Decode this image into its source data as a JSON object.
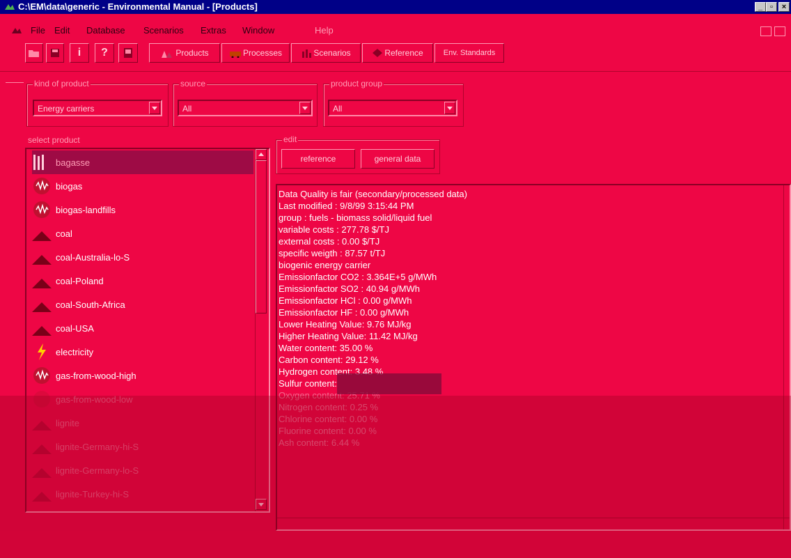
{
  "window": {
    "title": "C:\\EM\\data\\generic - Environmental Manual - [Products]"
  },
  "menu": [
    "File",
    "Edit",
    "Database",
    "Scenarios",
    "Extras",
    "Window",
    "Help"
  ],
  "toolbar": {
    "tabs": [
      "Products",
      "Processes",
      "Scenarios",
      "Reference",
      "Env. Standards"
    ]
  },
  "filters": {
    "kind_label": "kind of product",
    "kind_value": "Energy carriers",
    "source_label": "source",
    "source_value": "All",
    "group_label": "product group",
    "group_value": "All"
  },
  "products": {
    "label": "select product",
    "items": [
      {
        "label": "bagasse",
        "icon": "bagasse-icon"
      },
      {
        "label": "biogas",
        "icon": "gas-icon"
      },
      {
        "label": "biogas-landfills",
        "icon": "gas-icon"
      },
      {
        "label": "coal",
        "icon": "coal-icon"
      },
      {
        "label": "coal-Australia-lo-S",
        "icon": "coal-icon"
      },
      {
        "label": "coal-Poland",
        "icon": "coal-icon"
      },
      {
        "label": "coal-South-Africa",
        "icon": "coal-icon"
      },
      {
        "label": "coal-USA",
        "icon": "coal-icon"
      },
      {
        "label": "electricity",
        "icon": "electricity-icon"
      },
      {
        "label": "gas-from-wood-high",
        "icon": "gas-icon"
      },
      {
        "label": "gas-from-wood-low",
        "icon": "gas-icon"
      },
      {
        "label": "lignite",
        "icon": "coal-icon"
      },
      {
        "label": "lignite-Germany-hi-S",
        "icon": "coal-icon"
      },
      {
        "label": "lignite-Germany-lo-S",
        "icon": "coal-icon"
      },
      {
        "label": "lignite-Turkey-hi-S",
        "icon": "coal-icon"
      }
    ]
  },
  "edit": {
    "label": "edit",
    "reference_button": "reference",
    "general_data_button": "general data"
  },
  "info_lines": [
    "Data Quality is fair (secondary/processed data)",
    "Last modified : 9/8/99 3:15:44 PM",
    "group : fuels - biomass solid/liquid fuel",
    "variable costs : 277.78 $/TJ",
    "external costs : 0.00 $/TJ",
    "specific weigth : 87.57 t/TJ",
    "biogenic energy carrier",
    "Emissionfactor CO2 : 3.364E+5 g/MWh",
    "Emissionfactor SO2 : 40.94 g/MWh",
    "Emissionfactor HCl : 0.00 g/MWh",
    "Emissionfactor HF : 0.00 g/MWh",
    "Lower Heating Value: 9.76 MJ/kg",
    "Higher Heating Value: 11.42 MJ/kg",
    "Water content: 35.00 %",
    "Carbon content: 29.12 %",
    "Hydrogen content: 3.48 %",
    "Sulfur content: ",
    "Oxygen content: 25.71 %",
    "Nitrogen content: 0.25 %",
    "Chlorine content: 0.00 %",
    "Fluorine content: 0.00 %",
    "Ash content: 6.44 %"
  ]
}
